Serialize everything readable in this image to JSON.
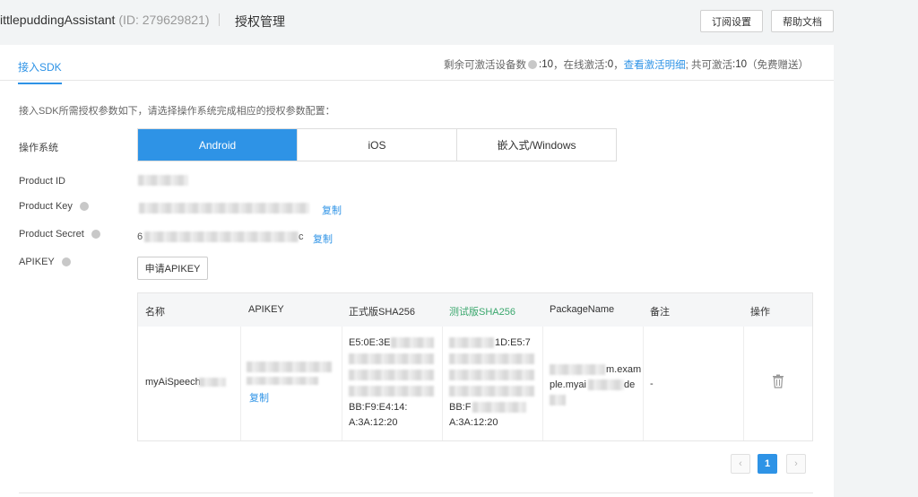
{
  "header": {
    "app_name": "ittlepuddingAssistant",
    "app_id": "(ID: 279629821)",
    "separator": "|",
    "page_title": "授权管理",
    "subscribe_label": "订阅设置",
    "help_label": "帮助文档"
  },
  "tabs": [
    {
      "label": "接入SDK",
      "active": true
    }
  ],
  "quota": {
    "remaining_label": "剩余可激活设备数",
    "remaining_value": ":10",
    "online_label": "，在线激活",
    "online_value": ":0",
    "comma": "，",
    "detail_link": "查看激活明细",
    "total_label": "; 共可激活",
    "total_value": ":10",
    "free_note": "（免费赠送）"
  },
  "description": "接入SDK所需授权参数如下，请选择操作系统完成相应的授权参数配置：",
  "fields": {
    "os_label": "操作系统",
    "product_id_label": "Product ID",
    "product_key_label": "Product Key",
    "product_secret_label": "Product Secret",
    "apikey_label": "APIKEY"
  },
  "os_options": [
    {
      "label": "Android",
      "selected": true
    },
    {
      "label": "iOS",
      "selected": false
    },
    {
      "label": "嵌入式/Windows",
      "selected": false
    }
  ],
  "copy_label": "复制",
  "secret_prefix": "6",
  "secret_suffix": "c",
  "apply_apikey_label": "申请APIKEY",
  "table": {
    "columns": [
      "名称",
      "APIKEY",
      "正式版SHA256",
      "测试版SHA256",
      "PackageName",
      "备注",
      "操作"
    ],
    "row": {
      "name": "myAiSpeech",
      "apikey_copy": "复制",
      "sha_release_top": "E5:0E:3E",
      "sha_release_bottom1": "BB:F9:E4:14:",
      "sha_release_bottom2": "A:3A:12:20",
      "sha_test_top": "1D:E5:7",
      "sha_test_bottom1": "BB:F",
      "sha_test_bottom2": "A:3A:12:20",
      "package_line1": "m.exam",
      "package_line2": "ple.myai",
      "package_line2_end": "de",
      "remark": "-"
    }
  },
  "pagination": {
    "prev": "‹",
    "page": "1",
    "next": "›"
  },
  "icons": {
    "info": "info-icon",
    "trash": "trash-icon"
  },
  "colors": {
    "accent": "#2e93e6",
    "green_header": "#3aa76d",
    "background": "#f2f4f5"
  }
}
